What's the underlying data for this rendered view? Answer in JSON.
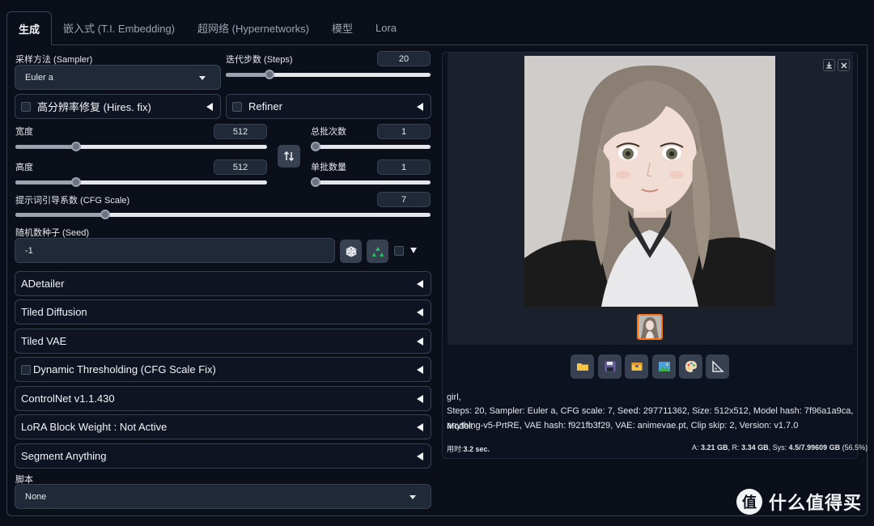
{
  "tabs": [
    {
      "label": "生成",
      "active": true
    },
    {
      "label": "嵌入式 (T.I. Embedding)"
    },
    {
      "label": "超网络 (Hypernetworks)"
    },
    {
      "label": "模型"
    },
    {
      "label": "Lora"
    }
  ],
  "sampler": {
    "label": "采样方法 (Sampler)",
    "value": "Euler a"
  },
  "steps": {
    "label": "迭代步数 (Steps)",
    "value": "20",
    "level": 0.2
  },
  "hires": {
    "label": "高分辨率修复 (Hires. fix)",
    "checked": false
  },
  "refiner": {
    "label": "Refiner",
    "checked": false
  },
  "width": {
    "label": "宽度",
    "value": "512",
    "level": 0.23
  },
  "height": {
    "label": "高度",
    "value": "512",
    "level": 0.23
  },
  "batch_count": {
    "label": "总批次数",
    "value": "1",
    "level": 0.0
  },
  "batch_size": {
    "label": "单批数量",
    "value": "1",
    "level": 0.0
  },
  "swap_icon": "swap-vertical-arrows",
  "cfg": {
    "label": "提示词引导系数 (CFG Scale)",
    "value": "7",
    "level": 0.21
  },
  "seed": {
    "label": "随机数种子 (Seed)",
    "value": "-1",
    "dice_icon": "dice",
    "recycle_icon": "recycle"
  },
  "accordions": [
    {
      "label": "ADetailer"
    },
    {
      "label": "Tiled Diffusion"
    },
    {
      "label": "Tiled VAE"
    },
    {
      "label": "Dynamic Thresholding (CFG Scale Fix)",
      "checkbox": true
    },
    {
      "label": "ControlNet v1.1.430"
    },
    {
      "label": "LoRA Block Weight : Not Active"
    },
    {
      "label": "Segment Anything"
    }
  ],
  "script": {
    "label": "脚本",
    "value": "None"
  },
  "output": {
    "tools": [
      "folder-icon",
      "save-icon",
      "zip-icon",
      "image-icon",
      "palette-icon",
      "ruler-icon"
    ],
    "prompt": "girl,",
    "params_line1": "Steps: 20, Sampler: Euler a, CFG scale: 7, Seed: 297711362, Size: 512x512, Model hash: 7f96a1a9ca, Model:",
    "params_line2": "anything-v5-PrtRE, VAE hash: f921fb3f29, VAE: animevae.pt, Clip skip: 2, Version: v1.7.0",
    "time_label": "用时:",
    "time_value": "3.2 sec.",
    "mem_a_label": "A: ",
    "mem_a_value": "3.21 GB",
    "mem_r_label": ", R: ",
    "mem_r_value": "3.34 GB",
    "mem_sys_label": ", Sys: ",
    "mem_sys_value": "4.5/7.99609 GB",
    "mem_pct": " (56.5%)"
  },
  "watermark": {
    "symbol": "值",
    "text": "什么值得买"
  }
}
